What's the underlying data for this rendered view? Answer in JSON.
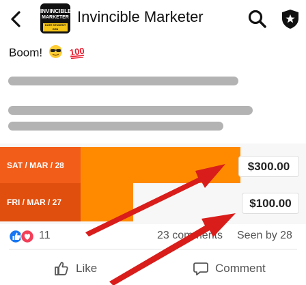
{
  "header": {
    "title": "Invincible Marketer",
    "logo_line1": "INVINCIBLE",
    "logo_line2": "MARKETER",
    "logo_line3": "DATE STUDENT GEN"
  },
  "post": {
    "text": "Boom!",
    "emoji_1": "😎",
    "emoji_2": "💯"
  },
  "image": {
    "rows": [
      {
        "date": "SAT / MAR / 28",
        "amount": "$300.00"
      },
      {
        "date": "FRI / MAR / 27",
        "amount": "$100.00"
      }
    ]
  },
  "stats": {
    "reaction_count": "11",
    "comments": "23 comments",
    "seen": "Seen by 28"
  },
  "actions": {
    "like": "Like",
    "comment": "Comment"
  },
  "colors": {
    "orange": "#ff8a00",
    "date_red": "#f25d1a",
    "arrow_red": "#e0211c",
    "like_blue": "#1877f2",
    "love_red": "#f33e58"
  },
  "icons": [
    "back-arrow-icon",
    "search-icon",
    "shield-star-icon",
    "like-reaction-icon",
    "love-reaction-icon",
    "thumbs-up-icon",
    "comment-icon",
    "red-arrow-icon"
  ]
}
